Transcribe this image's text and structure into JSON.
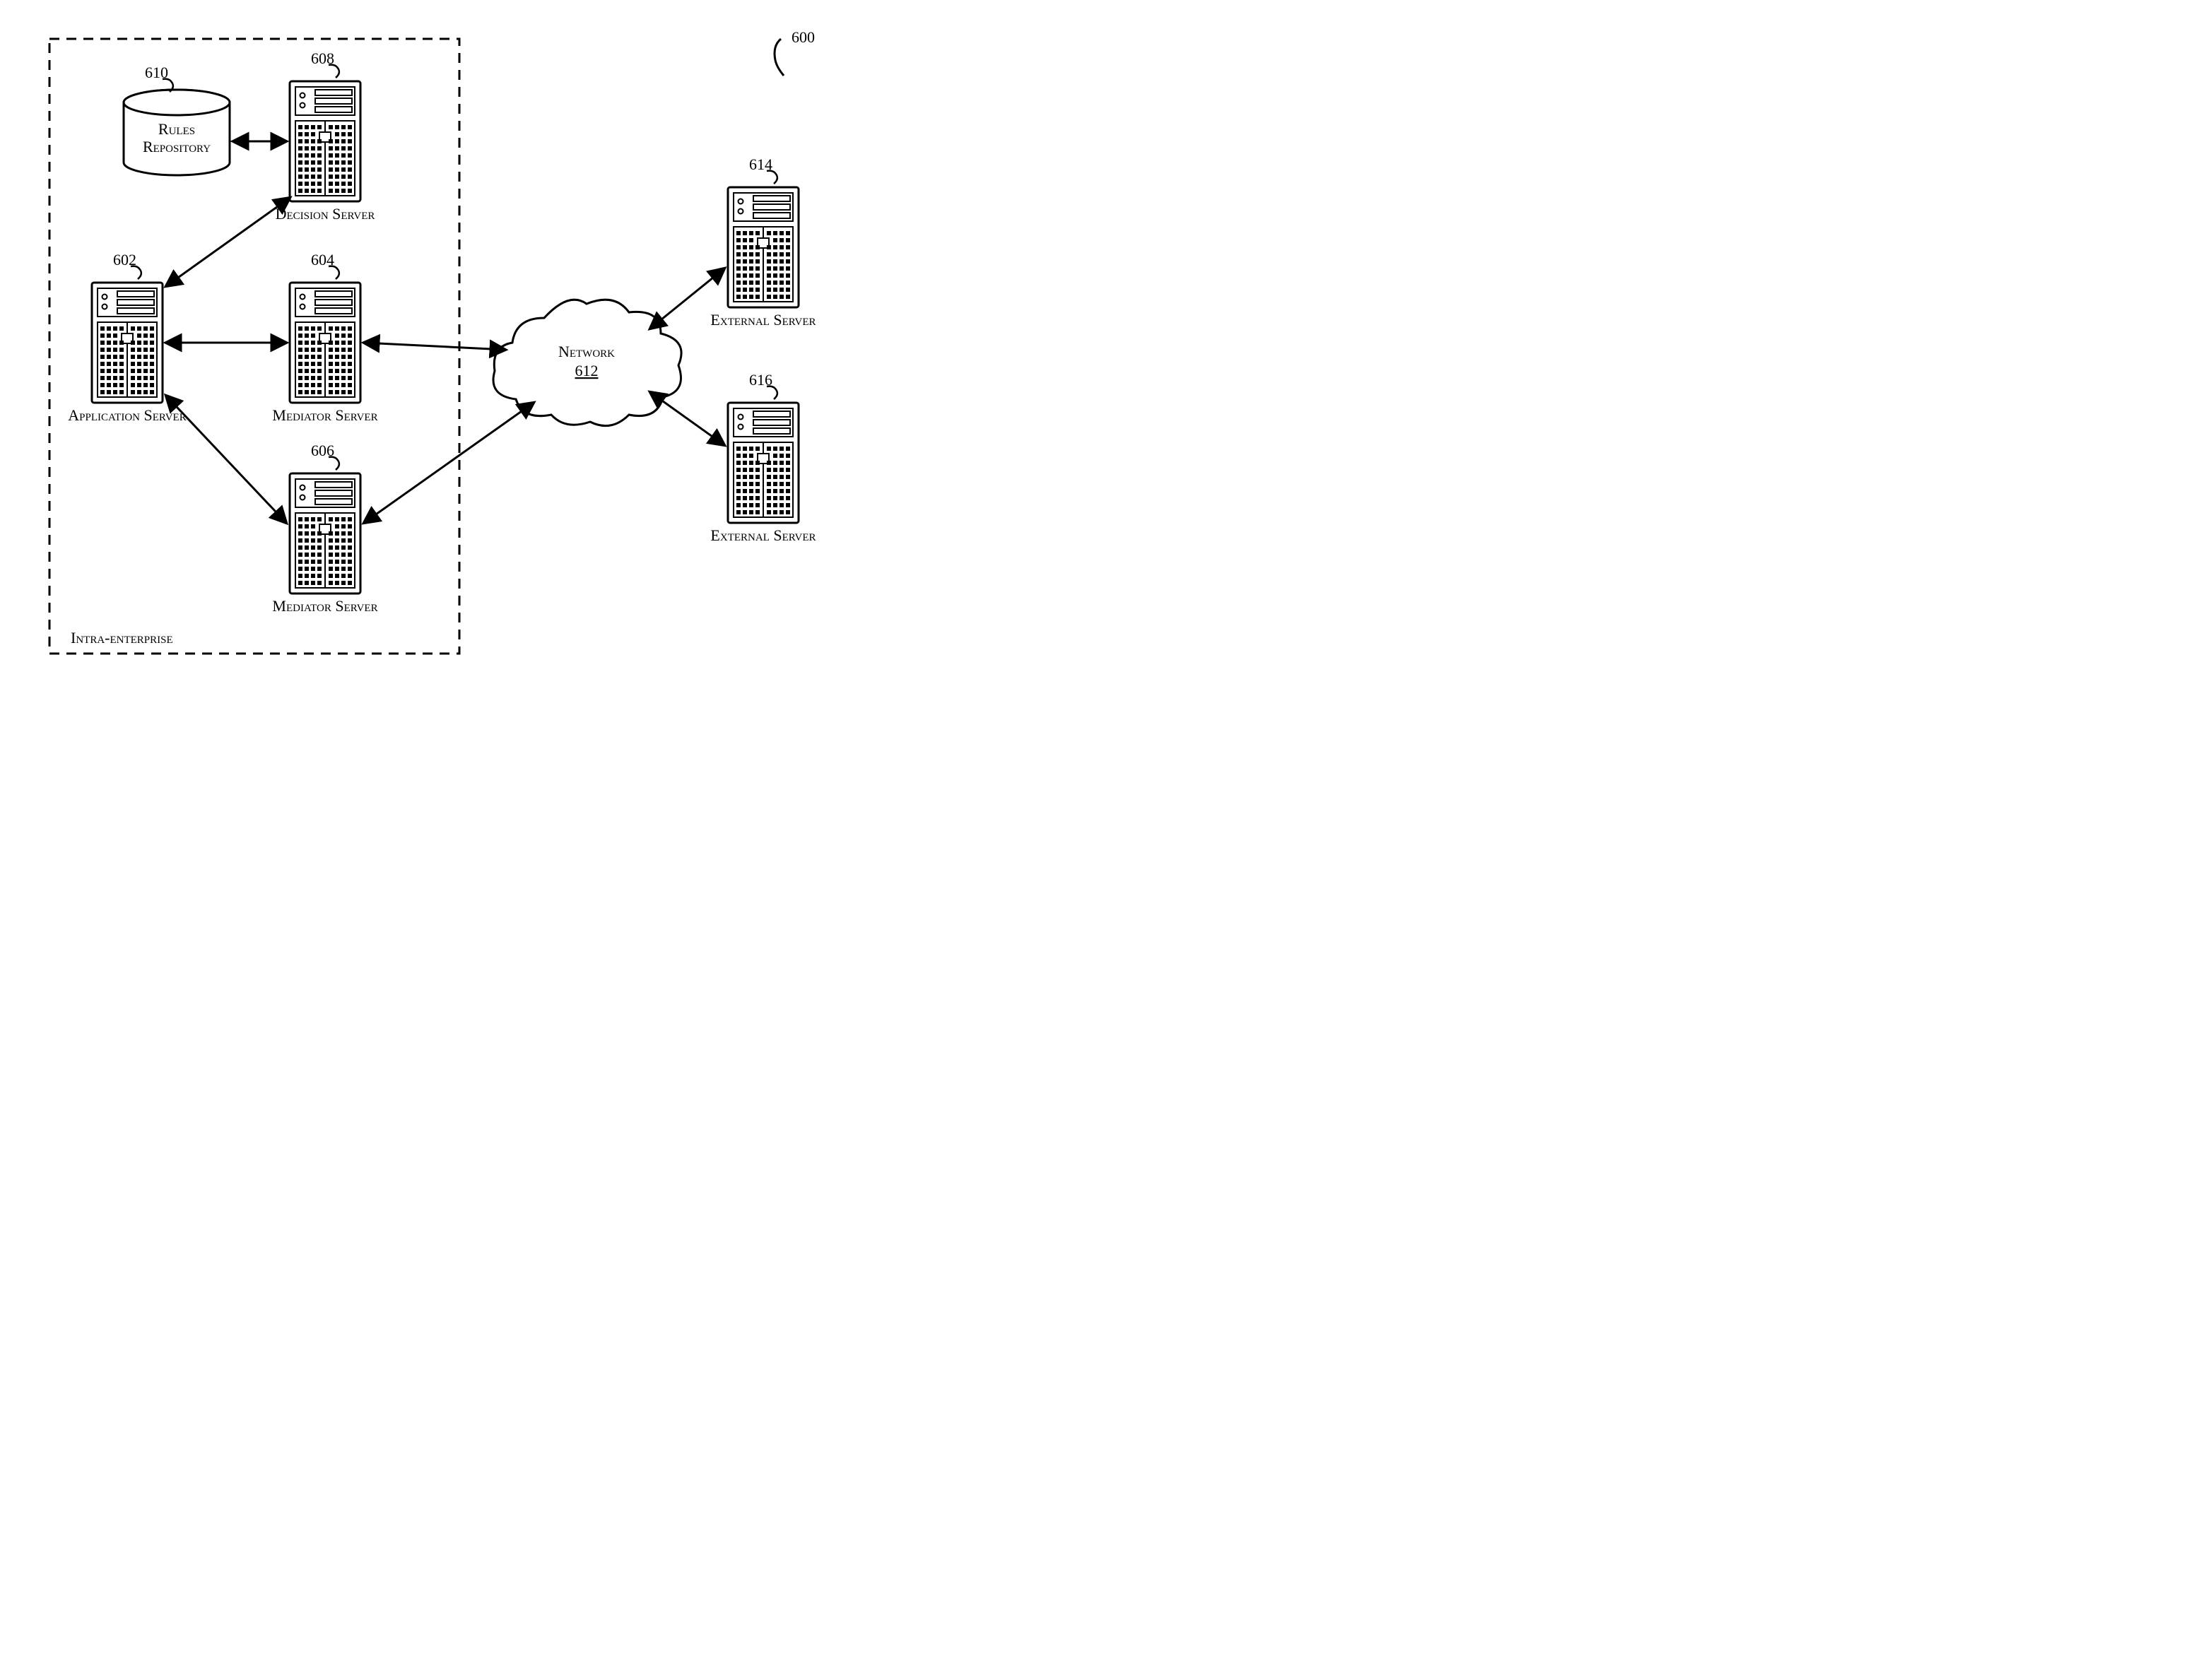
{
  "figure_ref": "600",
  "region_label": "Intra-enterprise",
  "nodes": {
    "rules_repo": {
      "ref": "610",
      "label": "Rules Repository"
    },
    "decision": {
      "ref": "608",
      "label": "Decision Server"
    },
    "application": {
      "ref": "602",
      "label": "Application Server"
    },
    "mediator1": {
      "ref": "604",
      "label": "Mediator Server"
    },
    "mediator2": {
      "ref": "606",
      "label": "Mediator Server"
    },
    "network": {
      "ref": "612",
      "label": "Network"
    },
    "external1": {
      "ref": "614",
      "label": "External Server"
    },
    "external2": {
      "ref": "616",
      "label": "External Server"
    }
  },
  "connections": [
    [
      "rules_repo",
      "decision"
    ],
    [
      "decision",
      "application"
    ],
    [
      "application",
      "mediator1"
    ],
    [
      "application",
      "mediator2"
    ],
    [
      "mediator1",
      "network"
    ],
    [
      "mediator2",
      "network"
    ],
    [
      "network",
      "external1"
    ],
    [
      "network",
      "external2"
    ]
  ]
}
